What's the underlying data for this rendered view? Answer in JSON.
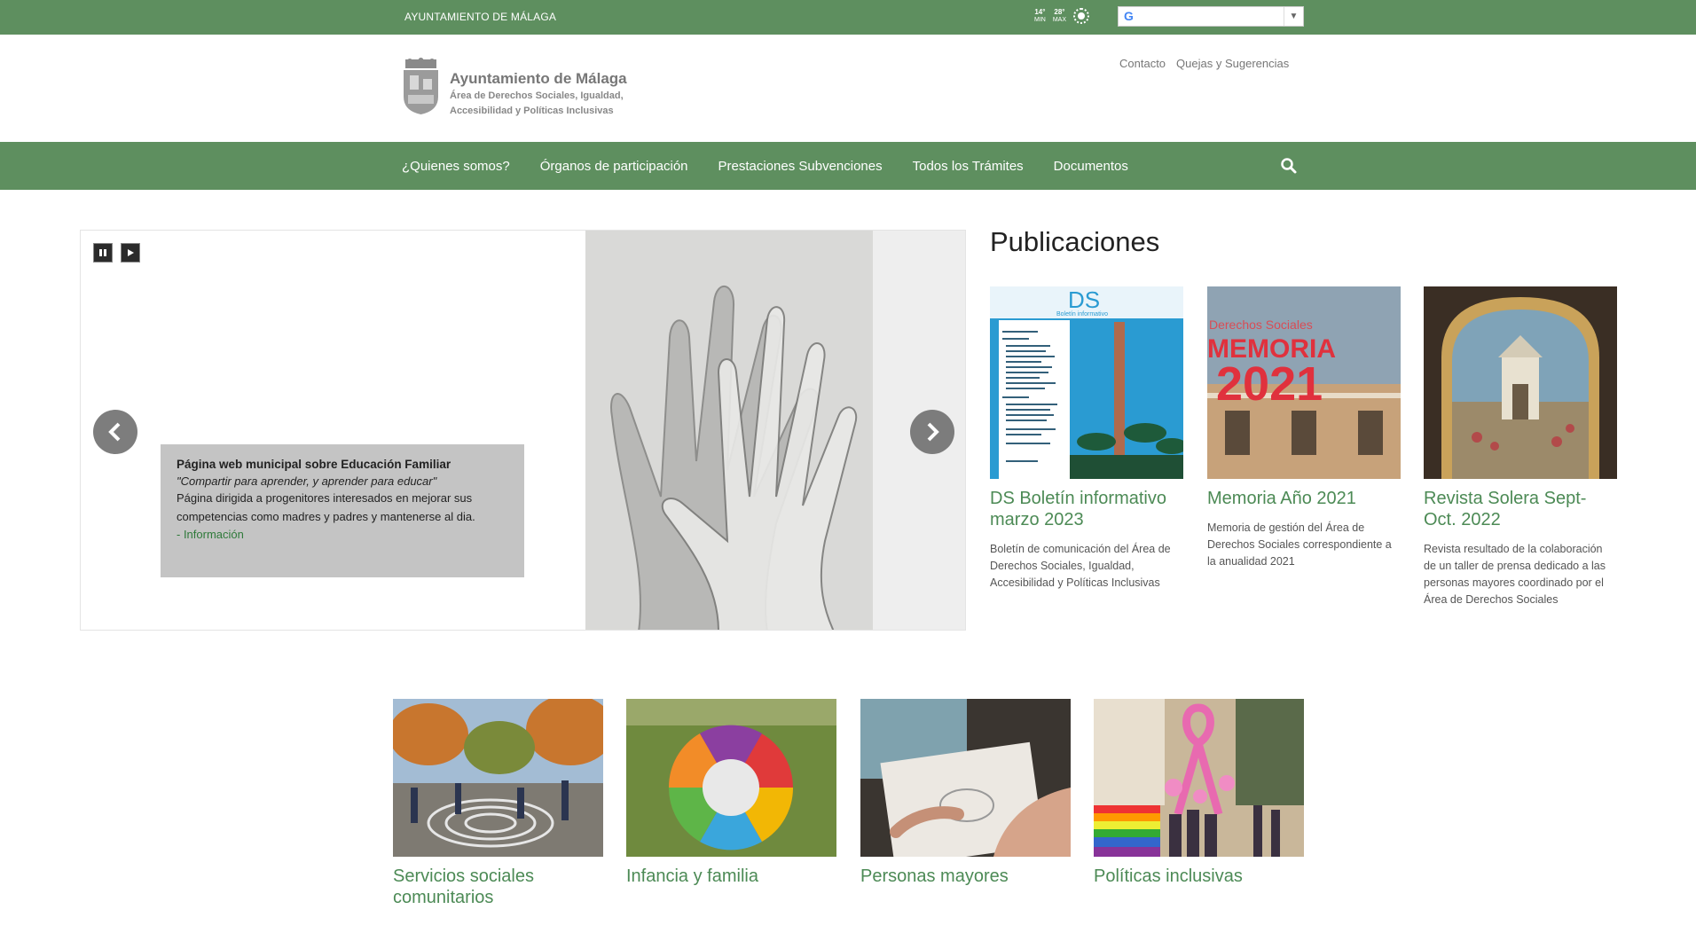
{
  "topbar": {
    "title": "AYUNTAMIENTO DE MÁLAGA",
    "weather": {
      "min_temp": "14°",
      "min_label": "MIN",
      "max_temp": "28°",
      "max_label": "MAX"
    },
    "translate_value": ""
  },
  "header": {
    "logo_title": "Ayuntamiento de Málaga",
    "logo_subtitle_1": "Área de Derechos Sociales, Igualdad,",
    "logo_subtitle_2": "Accesibilidad y Políticas Inclusivas",
    "links": [
      "Contacto",
      "Quejas y Sugerencias"
    ]
  },
  "nav": {
    "items": [
      "¿Quienes somos?",
      "Órganos de participación",
      "Prestaciones Subvenciones",
      "Todos los Trámites",
      "Documentos"
    ]
  },
  "slider": {
    "caption_title": "Página web municipal sobre Educación Familiar",
    "caption_quote": "\"Compartir para aprender, y aprender para educar\"",
    "caption_text": "Página dirigida a progenitores interesados en mejorar sus competencias como madres y padres y mantenerse al dia.",
    "caption_link": "- Información"
  },
  "publicaciones": {
    "title": "Publicaciones",
    "items": [
      {
        "title": "DS Boletín informativo marzo 2023",
        "desc": "Boletín de comunicación del Área de Derechos Sociales, Igualdad, Accesibilidad y Políticas Inclusivas",
        "thumb_text": "DS",
        "thumb_sub": "Boletín informativo"
      },
      {
        "title": "Memoria Año 2021",
        "desc": "Memoria de gestión del Área de Derechos Sociales correspondiente a la anualidad 2021",
        "thumb_text": "MEMORIA",
        "thumb_sub": "Derechos Sociales",
        "thumb_year": "2021"
      },
      {
        "title": "Revista Solera Sept-Oct. 2022",
        "desc": "Revista resultado de la colaboración de un taller de prensa dedicado a las personas mayores coordinado por el Área de Derechos Sociales"
      }
    ]
  },
  "categories": {
    "items": [
      "Servicios sociales comunitarios",
      "Infancia y familia",
      "Personas mayores",
      "Políticas inclusivas"
    ]
  },
  "colors": {
    "brand_green": "#5e8f5f",
    "link_green": "#4c8a55"
  }
}
